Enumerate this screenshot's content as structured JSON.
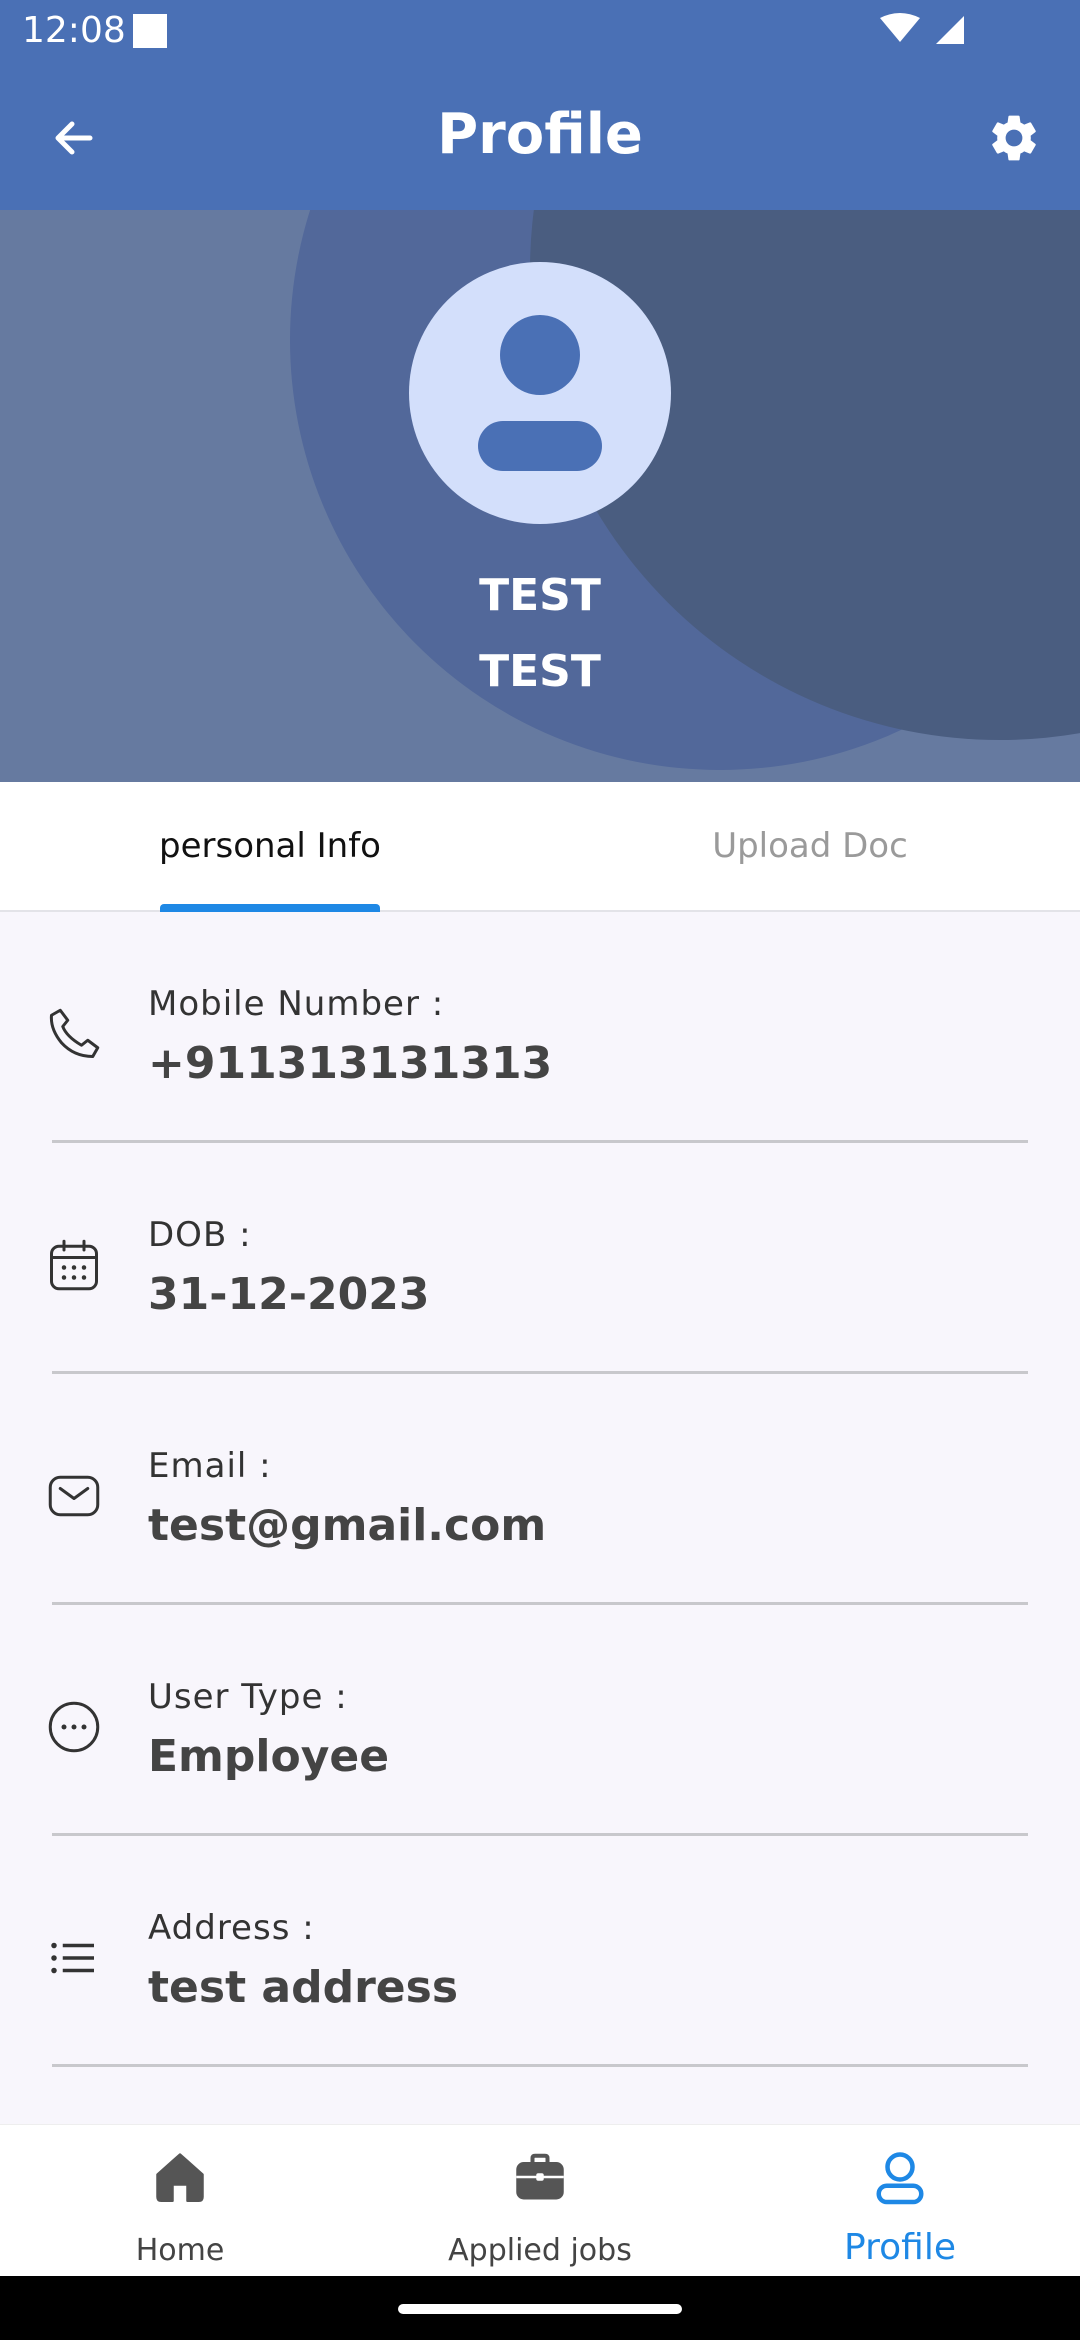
{
  "status_bar": {
    "time": "12:08"
  },
  "app_bar": {
    "title": "Profile"
  },
  "profile": {
    "first_name": "TEST",
    "last_name": "TEST"
  },
  "tabs": [
    {
      "label": "personal Info",
      "active": true
    },
    {
      "label": "Upload Doc",
      "active": false
    }
  ],
  "info": [
    {
      "icon": "phone-icon",
      "label": "Mobile Number :",
      "value": "+911313131313"
    },
    {
      "icon": "calendar-icon",
      "label": "DOB :",
      "value": "31-12-2023"
    },
    {
      "icon": "email-icon",
      "label": "Email :",
      "value": "test@gmail.com"
    },
    {
      "icon": "more-horizontal-circle-icon",
      "label": "User Type :",
      "value": "Employee"
    },
    {
      "icon": "list-icon",
      "label": "Address :",
      "value": "test address"
    }
  ],
  "bottom_nav": [
    {
      "icon": "home-icon",
      "label": "Home",
      "active": false
    },
    {
      "icon": "briefcase-icon",
      "label": "Applied jobs",
      "active": false
    },
    {
      "icon": "person-icon",
      "label": "Profile",
      "active": true
    }
  ],
  "colors": {
    "app_bar": "#4a70b5",
    "accent": "#1e88e5",
    "avatar_bg": "#d3dffb",
    "avatar_fg": "#4a70b5"
  }
}
